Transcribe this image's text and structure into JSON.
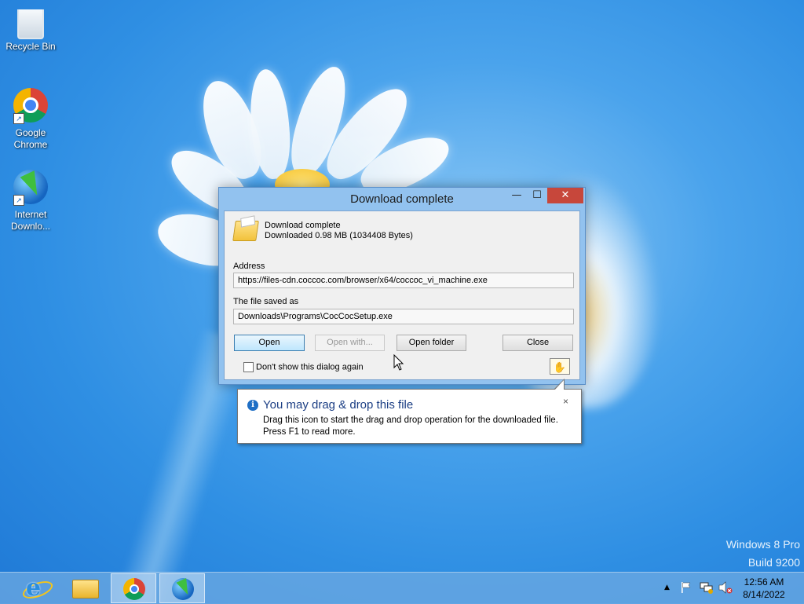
{
  "desktop": {
    "icons": [
      {
        "label": "Recycle Bin"
      },
      {
        "label": "Google Chrome"
      },
      {
        "label": "Internet Downlo..."
      }
    ],
    "watermark": {
      "line1": "Windows 8 Pro",
      "line2": "Build 9200"
    }
  },
  "dialog": {
    "title": "Download complete",
    "controls": {
      "minimize": "—",
      "maximize": "☐",
      "close": "✕"
    },
    "header_line1": "Download complete",
    "header_line2": "Downloaded 0.98  MB (1034408 Bytes)",
    "address_label": "Address",
    "address_value": "https://files-cdn.coccoc.com/browser/x64/coccoc_vi_machine.exe",
    "saved_label": "The file saved as",
    "saved_value": "Downloads\\Programs\\CocCocSetup.exe",
    "buttons": {
      "open": "Open",
      "open_with": "Open with...",
      "open_folder": "Open folder",
      "close": "Close"
    },
    "checkbox_label": "Don't show this dialog again",
    "checkbox_checked": false,
    "drag_icon": "drag-drop-hand-icon"
  },
  "balloon": {
    "title": "You may drag & drop this file",
    "line1": "Drag this icon to start the drag and drop operation for the downloaded file.",
    "line2": "Press F1 to read more.",
    "close": "×"
  },
  "taskbar": {
    "apps": [
      "internet-explorer",
      "file-explorer",
      "google-chrome",
      "internet-download-manager"
    ],
    "active_app": "internet-download-manager",
    "tray_icons": [
      "show-hidden-icons",
      "action-center-flag-icon",
      "network-icon",
      "volume-muted-icon"
    ],
    "time": "12:56 AM",
    "date": "8/14/2022"
  }
}
